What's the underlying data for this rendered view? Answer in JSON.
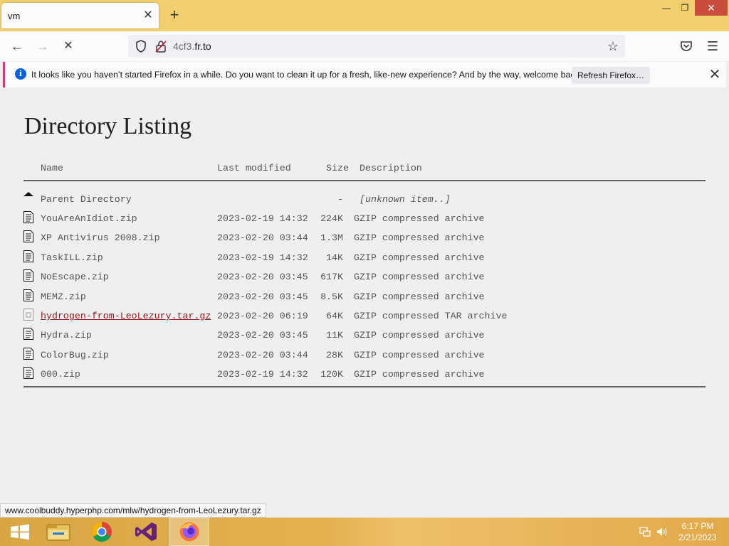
{
  "browser": {
    "tab": {
      "title": "vm",
      "close_glyph": "✕"
    },
    "new_tab_glyph": "+",
    "window_controls": {
      "minimize": "—",
      "restore": "❐",
      "close": "✕"
    },
    "nav": {
      "back_glyph": "←",
      "forward_glyph": "→",
      "stop_glyph": "✕",
      "star_glyph": "☆",
      "menu_glyph": "☰"
    },
    "url": {
      "prefix": "4cf3.",
      "host": "fr.to"
    }
  },
  "notification": {
    "icon_glyph": "i",
    "text": "It looks like you haven’t started Firefox in a while. Do you want to clean it up for a fresh, like-new experience? And by the way, welcome back!",
    "button": "Refresh Firefox…",
    "close_glyph": "✕"
  },
  "page": {
    "heading": "Directory Listing",
    "headers": {
      "name": "Name",
      "last_modified": "Last modified",
      "size": "Size",
      "description": "Description"
    },
    "parent": {
      "name": "Parent Directory",
      "size": "-",
      "description": "[unknown item..]"
    },
    "files": [
      {
        "name": "YouAreAnIdiot.zip",
        "modified": "2023-02-19 14:32",
        "size": "224K",
        "description": "GZIP compressed archive"
      },
      {
        "name": "XP Antivirus 2008.zip",
        "modified": "2023-02-20 03:44",
        "size": "1.3M",
        "description": "GZIP compressed archive"
      },
      {
        "name": "TaskILL.zip",
        "modified": "2023-02-19 14:32",
        "size": "14K",
        "description": "GZIP compressed archive"
      },
      {
        "name": "NoEscape.zip",
        "modified": "2023-02-20 03:45",
        "size": "617K",
        "description": "GZIP compressed archive"
      },
      {
        "name": "MEMZ.zip",
        "modified": "2023-02-20 03:45",
        "size": "8.5K",
        "description": "GZIP compressed archive"
      },
      {
        "name": "hydrogen-from-LeoLezury.tar.gz",
        "modified": "2023-02-20 06:19",
        "size": "64K",
        "description": "GZIP compressed TAR archive"
      },
      {
        "name": "Hydra.zip",
        "modified": "2023-02-20 03:45",
        "size": "11K",
        "description": "GZIP compressed archive"
      },
      {
        "name": "ColorBug.zip",
        "modified": "2023-02-20 03:44",
        "size": "28K",
        "description": "GZIP compressed archive"
      },
      {
        "name": "000.zip",
        "modified": "2023-02-19 14:32",
        "size": "120K",
        "description": "GZIP compressed archive"
      }
    ]
  },
  "status_bar": {
    "url": "www.coolbuddy.hyperphp.com/mlw/hydrogen-from-LeoLezury.tar.gz"
  },
  "taskbar": {
    "clock": {
      "time": "6:17 PM",
      "date": "2/21/2023"
    }
  }
}
